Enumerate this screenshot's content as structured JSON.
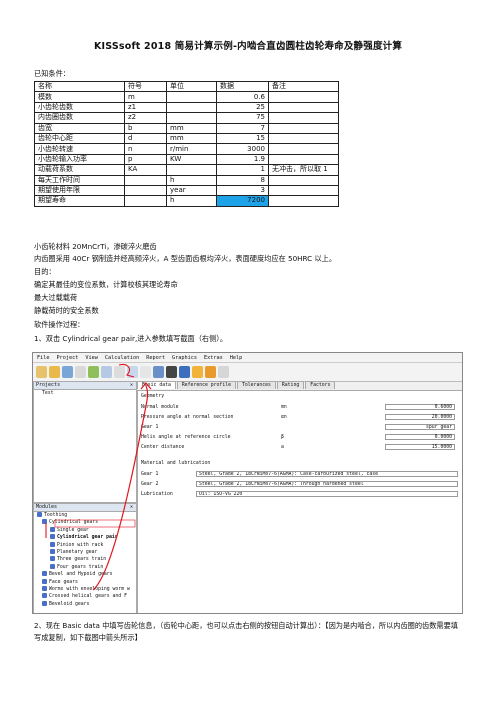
{
  "title": "KISSsoft 2018 简易计算示例-内啮合直齿圆柱齿轮寿命及静强度计算",
  "known_label": "已知条件：",
  "table": {
    "headers": [
      "名称",
      "符号",
      "单位",
      "数据",
      "备注"
    ],
    "rows": [
      [
        "模数",
        "m",
        "",
        "0.6",
        ""
      ],
      [
        "小齿轮齿数",
        "z1",
        "",
        "25",
        ""
      ],
      [
        "内齿圈齿数",
        "z2",
        "",
        "75",
        ""
      ],
      [
        "齿宽",
        "b",
        "mm",
        "7",
        ""
      ],
      [
        "齿轮中心距",
        "d",
        "mm",
        "15",
        ""
      ],
      [
        "小齿轮转速",
        "n",
        "r/min",
        "3000",
        ""
      ],
      [
        "小齿轮输入功率",
        "p",
        "KW",
        "1.9",
        ""
      ],
      [
        "动载荷系数",
        "KA",
        "",
        "1",
        "无冲击，所以取 1"
      ],
      [
        "每天工作时间",
        "",
        "h",
        "8",
        ""
      ],
      [
        "期望使用年限",
        "",
        "year",
        "3",
        ""
      ],
      [
        "期望寿命",
        "",
        "h",
        "7200",
        ""
      ]
    ]
  },
  "paragraphs": {
    "p1": "小齿轮材料 20MnCrTi，渗碳淬火磨齿",
    "p2": "内齿圈采用 40Cr 钢制造并经高频淬火，A 型齿面齿根均淬火，表面硬度均应在 50HRC 以上。",
    "p3": "目的：",
    "p4": "确定其最佳的变位系数，计算校核其理论寿命",
    "p5": "最大过载载荷",
    "p6": "静载荷时的安全系数",
    "p7": "软件操作过程：",
    "p8": "1、双击 Cylindrical gear pair,进入参数填写截面（右侧）。",
    "p9": "2、现在 Basic data 中填写齿轮信息，（齿轮中心距，也可以点击右侧的按钮自动计算出）：【因为是内啮合，所以内齿圈的齿数需要填写成复制，如下截图中箭头所示】"
  },
  "app": {
    "menu": [
      "File",
      "Project",
      "View",
      "Calculation",
      "Report",
      "Graphics",
      "Extras",
      "Help"
    ],
    "projects_header": "Projects",
    "project_item": "Test",
    "modules_header": "Modules",
    "modules": [
      "Toothing",
      "Cylindrical gears",
      "Single gear",
      "Cylindrical gear pair",
      "Pinion with rack",
      "Planetary gear",
      "Three gears train",
      "Four gears train",
      "Bevel and Hypoid gears",
      "Face gears",
      "Worms with enveloping worm w",
      "Crossed helical gears and F",
      "Beveloid gears"
    ],
    "tabs": [
      "Basic data",
      "Reference profile",
      "Tolerances",
      "Rating",
      "Factors"
    ],
    "geometry_label": "Geometry",
    "fields": [
      {
        "label": "Normal module",
        "symbol": "mn",
        "value": "0.6000"
      },
      {
        "label": "Pressure angle at normal section",
        "symbol": "αn",
        "value": "20.0000"
      },
      {
        "label": "Gear 1",
        "symbol": "",
        "value": "spur gear"
      },
      {
        "label": "Helix angle at reference circle",
        "symbol": "β",
        "value": "0.0000"
      },
      {
        "label": "Center distance",
        "symbol": "a",
        "value": "15.0000"
      }
    ],
    "material_label": "Material and lubrication",
    "gear1_label": "Gear 1",
    "gear1_value": "Steel, Grade 2, 18CrNiMo7-6(AGMA): Case-carburized steel, case",
    "gear2_label": "Gear 2",
    "gear2_value": "Steel, Grade 2, 18CrNiMo7-6(AGMA): Through hardened steel",
    "lube_label": "Lubrication",
    "lube_value": "Oil: ISO-VG 220"
  }
}
